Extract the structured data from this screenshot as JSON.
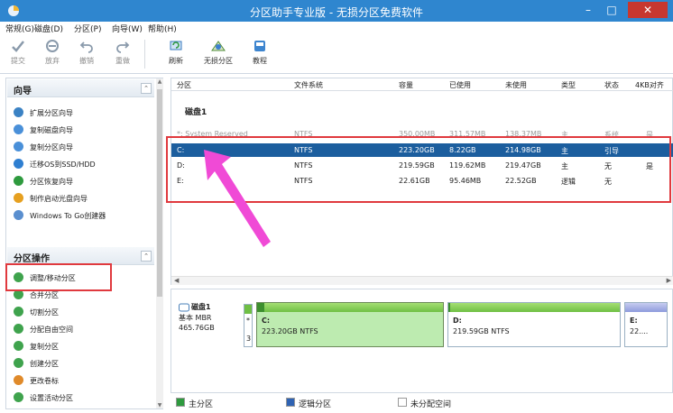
{
  "window": {
    "title": "分区助手专业版 - 无损分区免费软件",
    "minimize": "–",
    "maximize": "□",
    "close": "✕"
  },
  "menu": [
    "常规(G)",
    "磁盘(D)",
    "分区(P)",
    "向导(W)",
    "帮助(H)"
  ],
  "toolbar": [
    {
      "label": "提交",
      "icon": "commit-icon",
      "disabled": true
    },
    {
      "label": "放弃",
      "icon": "discard-icon",
      "disabled": true
    },
    {
      "label": "撤销",
      "icon": "undo-icon",
      "disabled": true
    },
    {
      "label": "重做",
      "icon": "redo-icon",
      "disabled": true
    },
    {
      "label": "刷新",
      "icon": "refresh-icon",
      "disabled": false
    },
    {
      "label": "无损分区",
      "icon": "lossless-partition-icon",
      "disabled": false
    },
    {
      "label": "教程",
      "icon": "tutorial-icon",
      "disabled": false
    }
  ],
  "sidebar": {
    "wizard": {
      "title": "向导",
      "items": [
        {
          "label": "扩展分区向导",
          "icon": "extend-wizard-icon",
          "color": "#3b82c4"
        },
        {
          "label": "复制磁盘向导",
          "icon": "copy-disk-icon",
          "color": "#4a90d9"
        },
        {
          "label": "复制分区向导",
          "icon": "copy-partition-icon",
          "color": "#4a90d9"
        },
        {
          "label": "迁移OS到SSD/HDD",
          "icon": "migrate-os-icon",
          "color": "#2f7fd1"
        },
        {
          "label": "分区恢复向导",
          "icon": "partition-recovery-icon",
          "color": "#2e9a3e"
        },
        {
          "label": "制作启动光盘向导",
          "icon": "boot-disc-icon",
          "color": "#e6a020"
        },
        {
          "label": "Windows To Go创建器",
          "icon": "windows-to-go-icon",
          "color": "#5a8fcf"
        }
      ]
    },
    "operations": {
      "title": "分区操作",
      "items": [
        {
          "label": "调整/移动分区",
          "icon": "resize-move-icon",
          "color": "#3fa34d"
        },
        {
          "label": "合并分区",
          "icon": "merge-icon",
          "color": "#3fa34d"
        },
        {
          "label": "切割分区",
          "icon": "split-icon",
          "color": "#3fa34d"
        },
        {
          "label": "分配自由空间",
          "icon": "allocate-space-icon",
          "color": "#3fa34d"
        },
        {
          "label": "复制分区",
          "icon": "copy-partition-op-icon",
          "color": "#3fa34d"
        },
        {
          "label": "创建分区",
          "icon": "create-partition-icon",
          "color": "#3fa34d"
        },
        {
          "label": "更改卷标",
          "icon": "change-label-icon",
          "color": "#e08a2a"
        },
        {
          "label": "设置活动分区",
          "icon": "set-active-icon",
          "color": "#3fa34d"
        }
      ]
    }
  },
  "partition_list": {
    "columns": [
      "分区",
      "文件系统",
      "容量",
      "已使用",
      "未使用",
      "类型",
      "状态",
      "4KB对齐"
    ],
    "disk_label": "磁盘1",
    "rows": [
      {
        "partition": "*: System Reserved",
        "fs": "NTFS",
        "capacity": "350.00MB",
        "used": "311.57MB",
        "unused": "138.37MB",
        "type": "主",
        "status": "系统",
        "align": "是",
        "ghost": true
      },
      {
        "partition": "C:",
        "fs": "NTFS",
        "capacity": "223.20GB",
        "used": "8.22GB",
        "unused": "214.98GB",
        "type": "主",
        "status": "引导",
        "align": "",
        "selected": true
      },
      {
        "partition": "D:",
        "fs": "NTFS",
        "capacity": "219.59GB",
        "used": "119.62MB",
        "unused": "219.47GB",
        "type": "主",
        "status": "无",
        "align": "是"
      },
      {
        "partition": "E:",
        "fs": "NTFS",
        "capacity": "22.61GB",
        "used": "95.46MB",
        "unused": "22.52GB",
        "type": "逻辑",
        "status": "无",
        "align": ""
      }
    ]
  },
  "disk_map": {
    "disk_name": "磁盘1",
    "disk_type": "基本 MBR",
    "disk_size": "465.76GB",
    "mini_star": "*",
    "mini_num": "3",
    "partitions": [
      {
        "letter": "C:",
        "info": "223.20GB NTFS",
        "used_fraction": 0.04,
        "selected": true
      },
      {
        "letter": "D:",
        "info": "219.59GB NTFS",
        "used_fraction": 0.01,
        "selected": false
      },
      {
        "letter": "E:",
        "info": "22....",
        "used_fraction": 0.0,
        "selected": false
      }
    ]
  },
  "legend": [
    {
      "label": "主分区",
      "color": "#2e9a3e"
    },
    {
      "label": "逻辑分区",
      "color": "#2f63b3"
    },
    {
      "label": "未分配空间",
      "color": "#ffffff"
    }
  ],
  "colors": {
    "title_bar": "#2f86cf",
    "selected_row": "#1c5e9e",
    "highlight_box": "#e0393e",
    "arrow": "#f04ad6"
  }
}
